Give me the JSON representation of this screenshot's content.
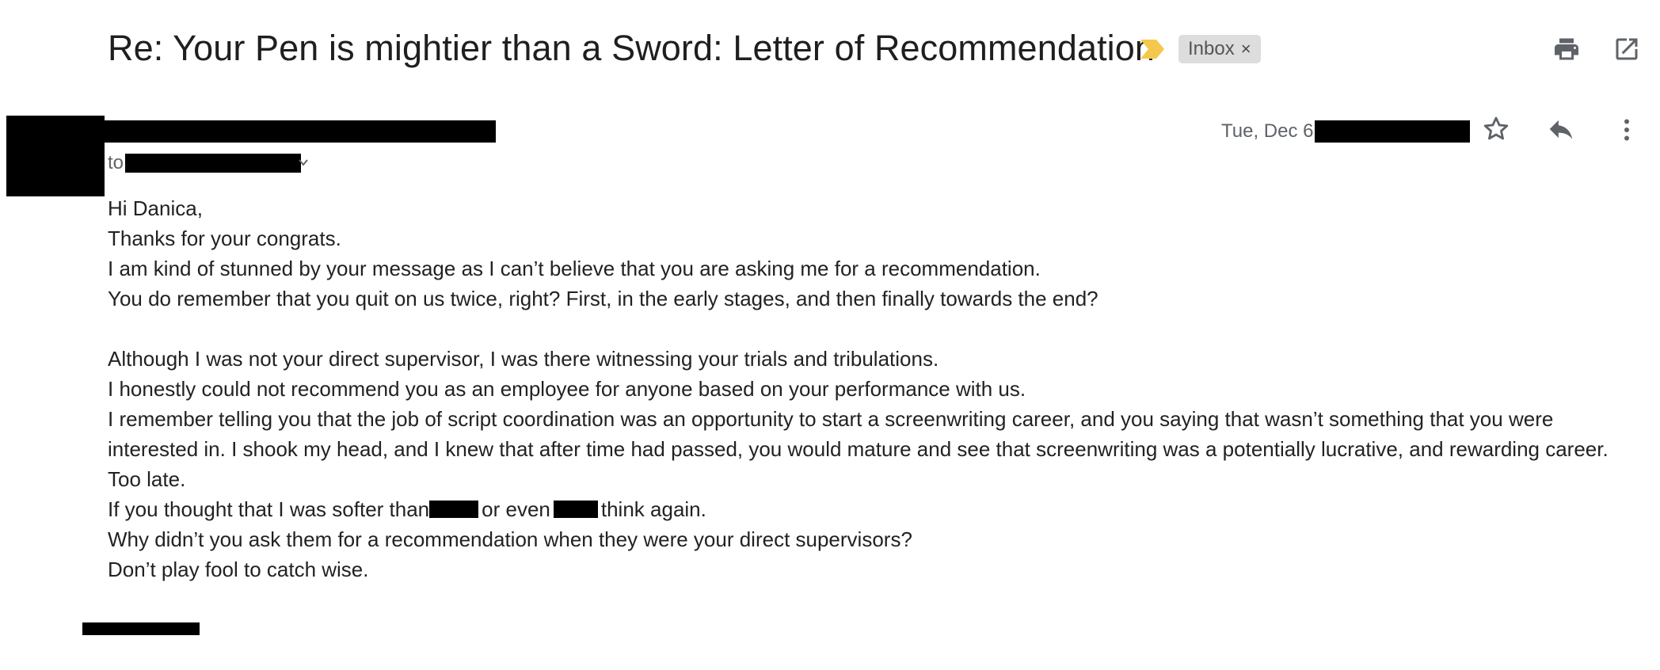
{
  "email": {
    "subject": "Re: Your Pen is mightier than a Sword: Letter of Recommendation",
    "label": "Inbox",
    "label_remove": "×",
    "to_prefix": "to",
    "date": "Tue, Dec 6"
  },
  "icons": {
    "important": "important-marker-icon",
    "print": "printer-icon",
    "open_new_window": "open-in-new-window-icon",
    "star": "star-icon",
    "reply": "reply-icon",
    "more": "more-vert-icon",
    "recipients_expand": "chevron-down-icon"
  },
  "colors": {
    "important_marker": "#f4c84a",
    "chip_bg": "#dddddd",
    "icon_gray": "#5f6368",
    "redaction": "#000000"
  },
  "body": {
    "line1": "Hi Danica,",
    "line2": "Thanks for your congrats.",
    "line3": "I am kind of stunned by your message as I can’t believe that you are asking me for a recommendation.",
    "line4": "You do remember that you quit on us twice, right?  First, in the early stages, and then finally towards the end?",
    "line5": "Although I was not your direct supervisor, I was there witnessing your trials and tribulations.",
    "line6": "I honestly could not recommend you as an employee for anyone based on your performance with us.",
    "line7": "I remember telling you that the job of script coordination was an opportunity to start a screenwriting career, and you saying that wasn’t something that you were",
    "line8": "interested in.  I shook my head, and I knew that after time had passed, you would mature and see that screenwriting was a potentially lucrative, and rewarding career.",
    "line9": "Too late.",
    "line10_a": "If you thought that I was softer than",
    "line10_b": "or even",
    "line10_c": "think again.",
    "line11": "Why didn’t you ask them for a recommendation when they were your direct supervisors?",
    "line12": "Don’t play fool to catch wise."
  }
}
